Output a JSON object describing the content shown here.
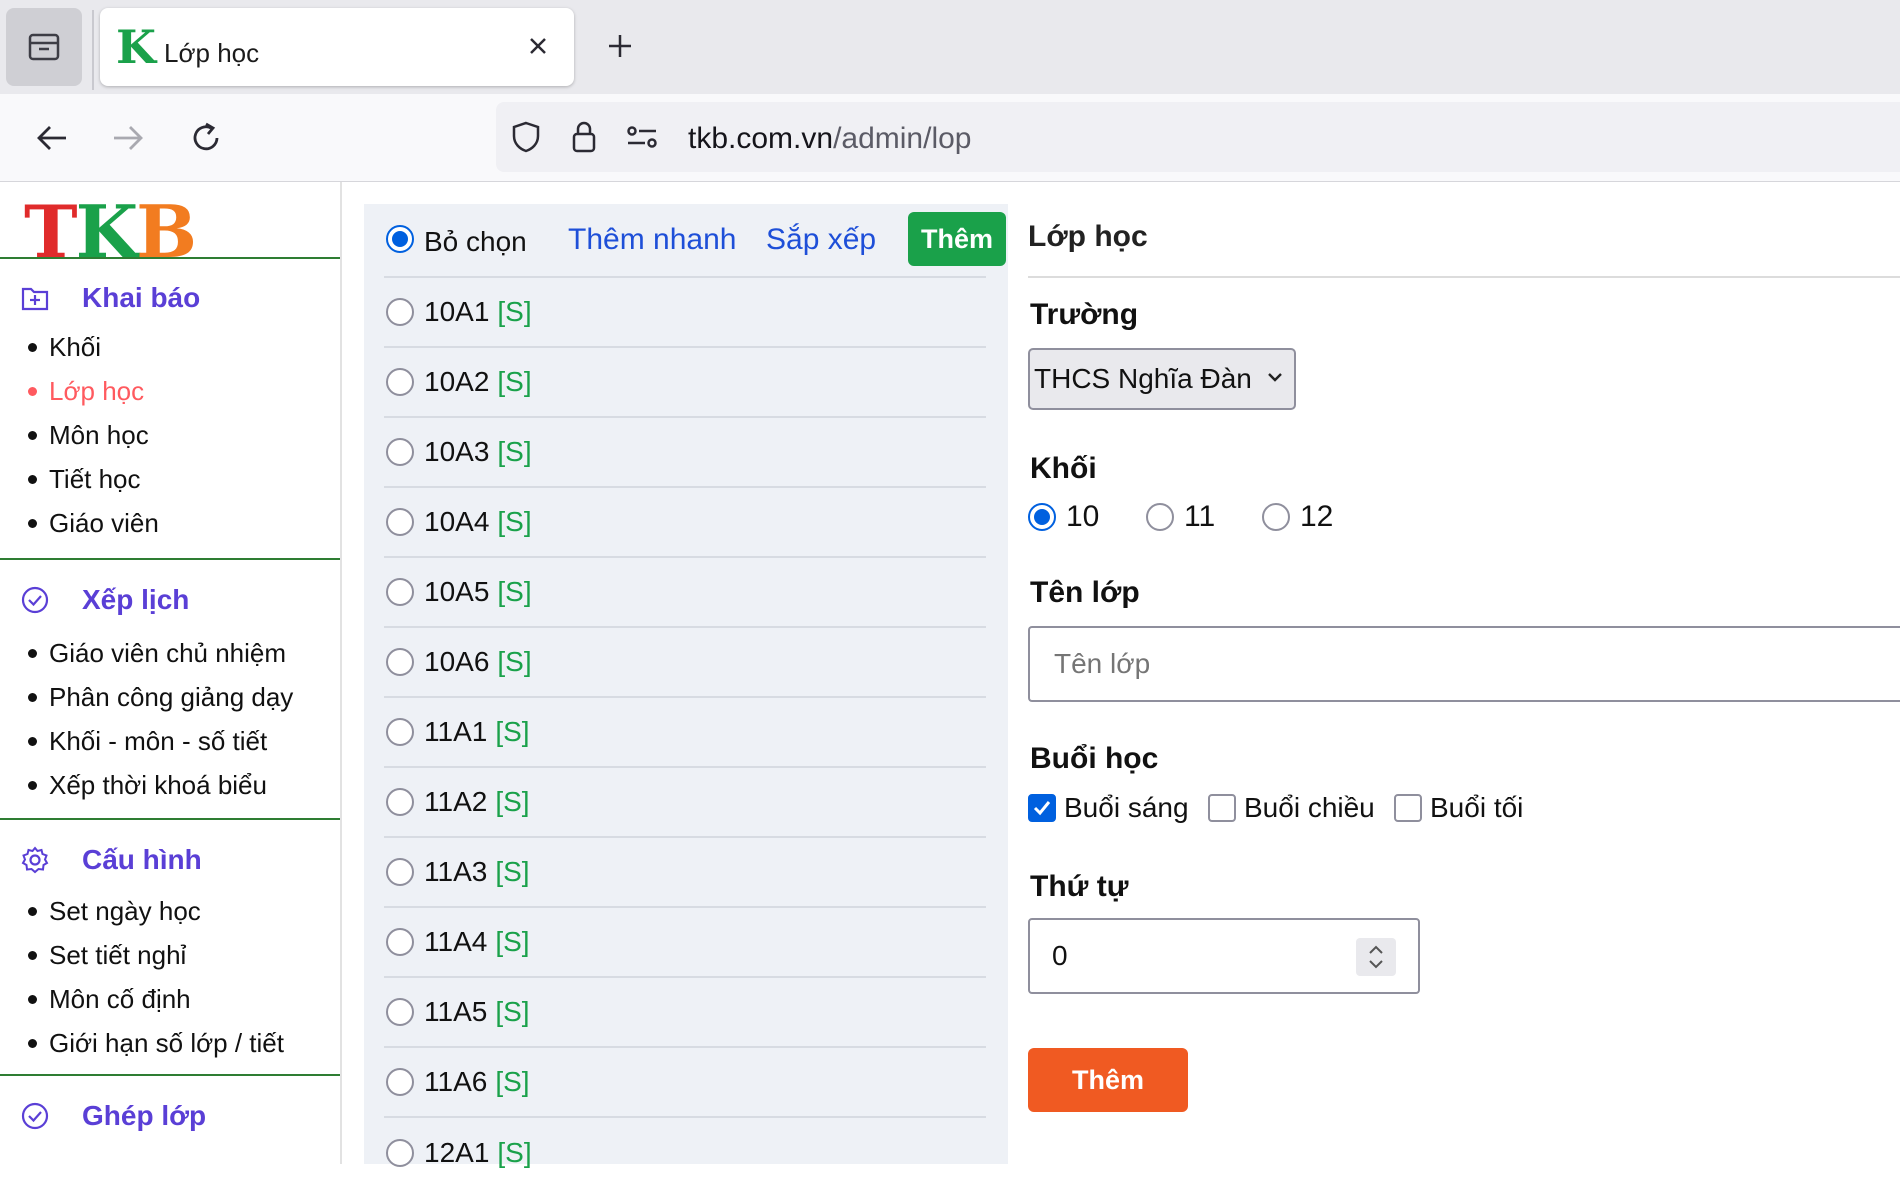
{
  "browser": {
    "tab_title": "Lớp học",
    "favicon_letter": "K",
    "url_domain": "tkb.com.vn",
    "url_path": "/admin/lop"
  },
  "logo": {
    "l1": "T",
    "l2": "K",
    "l3": "B"
  },
  "sidebar": {
    "sections": [
      {
        "title": "Khai báo",
        "icon": "plus-box-icon",
        "items": [
          "Khối",
          "Lớp học",
          "Môn học",
          "Tiết học",
          "Giáo viên"
        ]
      },
      {
        "title": "Xếp lịch",
        "icon": "check-circle-icon",
        "items": [
          "Giáo viên chủ nhiệm",
          "Phân công giảng dạy",
          "Khối - môn - số tiết",
          "Xếp thời khoá biểu"
        ]
      },
      {
        "title": "Cấu hình",
        "icon": "gear-icon",
        "items": [
          "Set ngày học",
          "Set tiết nghỉ",
          "Môn cố định",
          "Giới hạn số lớp / tiết"
        ]
      },
      {
        "title": "Ghép lớp",
        "icon": "check-circle-icon",
        "items": []
      }
    ],
    "active_item": "Lớp học"
  },
  "list": {
    "none_label": "Bỏ chọn",
    "quick_add": "Thêm nhanh",
    "sort": "Sắp xếp",
    "add": "Thêm",
    "tag": "[S]",
    "classes": [
      "10A1",
      "10A2",
      "10A3",
      "10A4",
      "10A5",
      "10A6",
      "11A1",
      "11A2",
      "11A3",
      "11A4",
      "11A5",
      "11A6",
      "12A1"
    ]
  },
  "form": {
    "title": "Lớp học",
    "school_label": "Trường",
    "school_value": "THCS Nghĩa Đàn",
    "grade_label": "Khối",
    "grades": [
      "10",
      "11",
      "12"
    ],
    "selected_grade": "10",
    "name_label": "Tên lớp",
    "name_placeholder": "Tên lớp",
    "session_label": "Buổi học",
    "sessions": [
      "Buổi sáng",
      "Buổi chiều",
      "Buổi tối"
    ],
    "checked_sessions": [
      "Buổi sáng"
    ],
    "order_label": "Thứ tự",
    "order_value": "0",
    "submit": "Thêm"
  },
  "colors": {
    "accent_green": "#1aa14a",
    "accent_orange": "#f05a22",
    "section_purple": "#5a3fd6",
    "link_blue": "#1e4fd8",
    "active_red": "#ff5a5f"
  }
}
